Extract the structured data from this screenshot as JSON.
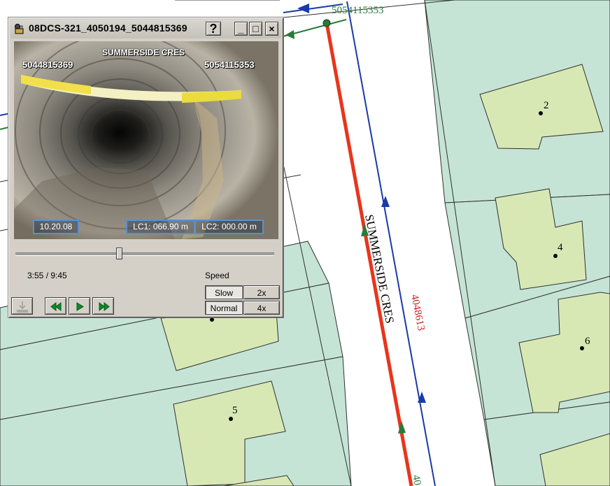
{
  "map": {
    "street_name": "SUMMERSIDE CRES",
    "pipe_id": "4048613",
    "manhole_top": "5054115353",
    "manhole_bottom_partial": "40",
    "house_numbers": [
      "2",
      "4",
      "6",
      "5"
    ],
    "colors": {
      "lot_fill": "#c5e4d6",
      "building_fill": "#d8e8b4",
      "main_pipe": "#e8351c",
      "flow_line": "#1a3aa8",
      "lateral_line": "#2a7a3a",
      "pipe_label": "#cc2020",
      "manhole_label": "#2a7a3a"
    }
  },
  "window": {
    "title": "08DCS-321_4050194_5044815369",
    "help_label": "?",
    "minimize_label": "_",
    "maximize_label": "□",
    "close_label": "×"
  },
  "video": {
    "street": "SUMMERSIDE CRES",
    "upstream_mh": "5044815369",
    "downstream_mh": "5054115353",
    "date": "10.20.08",
    "lc1": "LC1:   066.90 m",
    "lc2": "LC2:   000.00 m"
  },
  "player": {
    "time": "3:55 / 9:45",
    "progress_fraction": 0.4,
    "speed_label": "Speed",
    "speed_options": [
      "Slow",
      "2x",
      "Normal",
      "4x"
    ],
    "selected_speed": "Normal",
    "icons": [
      "export-icon",
      "rewind-icon",
      "play-icon",
      "fast-forward-icon"
    ]
  }
}
